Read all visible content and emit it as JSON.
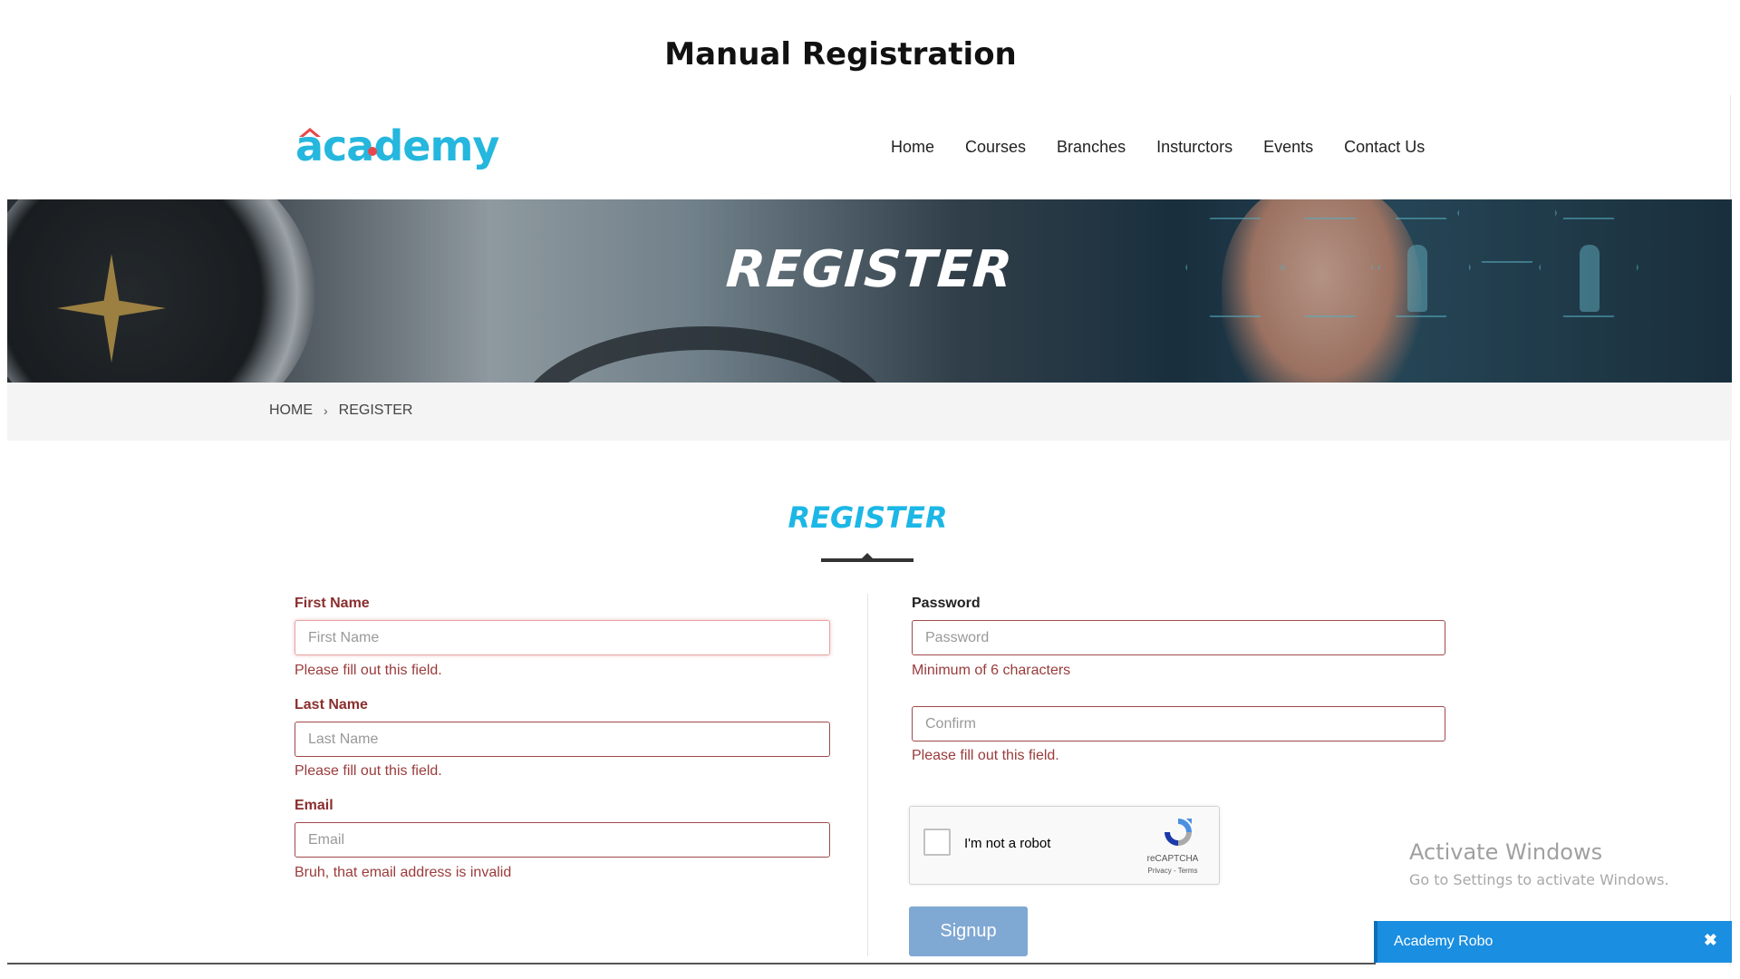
{
  "document_title": "Manual Registration",
  "header": {
    "logo_text": "academy",
    "nav": [
      "Home",
      "Courses",
      "Branches",
      "Insturctors",
      "Events",
      "Contact Us"
    ]
  },
  "hero": {
    "title": "REGISTER"
  },
  "breadcrumb": {
    "home": "HOME",
    "separator": "›",
    "current": "REGISTER"
  },
  "section": {
    "title": "REGISTER"
  },
  "form": {
    "first_name": {
      "label": "First Name",
      "placeholder": "First Name",
      "value": "",
      "error": "Please fill out this field."
    },
    "last_name": {
      "label": "Last Name",
      "placeholder": "Last Name",
      "value": "",
      "error": "Please fill out this field."
    },
    "email": {
      "label": "Email",
      "placeholder": "Email",
      "value": "",
      "error": "Bruh, that email address is invalid"
    },
    "password": {
      "label": "Password",
      "placeholder": "Password",
      "value": "",
      "hint": "Minimum of 6 characters"
    },
    "confirm": {
      "placeholder": "Confirm",
      "value": "",
      "error": "Please fill out this field."
    },
    "recaptcha": {
      "label": "I'm not a robot",
      "brand": "reCAPTCHA",
      "links": "Privacy - Terms",
      "checked": false
    },
    "submit_label": "Signup"
  },
  "os_overlay": {
    "title": "Activate Windows",
    "subtitle": "Go to Settings to activate Windows."
  },
  "chat_widget": {
    "title": "Academy Robo",
    "close_symbol": "✖"
  },
  "colors": {
    "brand": "#25b7dd",
    "accent_red": "#e8484d",
    "error": "#9a3b3b",
    "button": "#7fa8d3",
    "chat": "#1a8ee0"
  }
}
